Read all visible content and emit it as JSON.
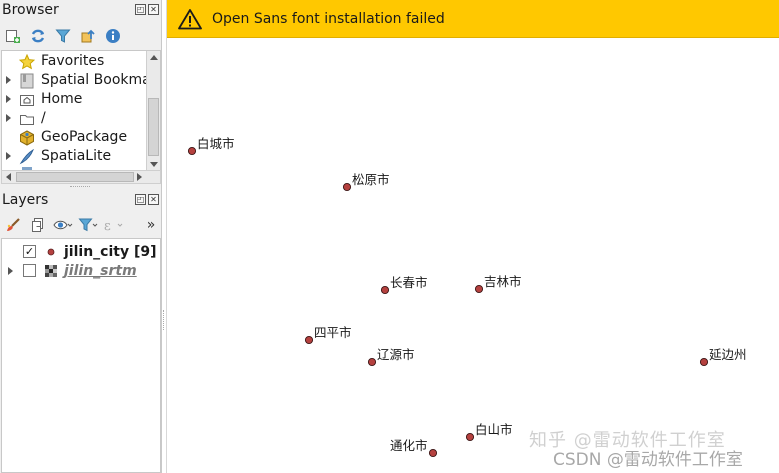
{
  "browser_panel": {
    "title": "Browser",
    "items": [
      {
        "label": "Favorites",
        "icon": "star-icon",
        "expandable": false
      },
      {
        "label": "Spatial Bookma",
        "icon": "bookmark-icon",
        "expandable": true
      },
      {
        "label": "Home",
        "icon": "home-folder-icon",
        "expandable": true
      },
      {
        "label": "/",
        "icon": "folder-icon",
        "expandable": true
      },
      {
        "label": "GeoPackage",
        "icon": "geopackage-icon",
        "expandable": false
      },
      {
        "label": "SpatiaLite",
        "icon": "spatialite-icon",
        "expandable": true
      }
    ]
  },
  "layers_panel": {
    "title": "Layers",
    "more_symbol": "»",
    "layers": [
      {
        "label": "jilin_city [9]",
        "checked": true,
        "icon": "point-layer-icon",
        "expandable": false
      },
      {
        "label": "jilin_srtm",
        "checked": false,
        "icon": "raster-layer-icon",
        "expandable": true
      }
    ]
  },
  "message_bar": {
    "text": "Open Sans font installation failed",
    "color": "#ffc800"
  },
  "map": {
    "point_color": "#b5413f",
    "cities": [
      {
        "name": "白城市"
      },
      {
        "name": "松原市"
      },
      {
        "name": "长春市"
      },
      {
        "name": "吉林市"
      },
      {
        "name": "四平市"
      },
      {
        "name": "辽源市"
      },
      {
        "name": "延边州"
      },
      {
        "name": "白山市"
      },
      {
        "name": "通化市"
      }
    ]
  },
  "watermark": {
    "line1": "知乎 @雷动软件工作室",
    "line2": "CSDN @雷动软件工作室"
  }
}
